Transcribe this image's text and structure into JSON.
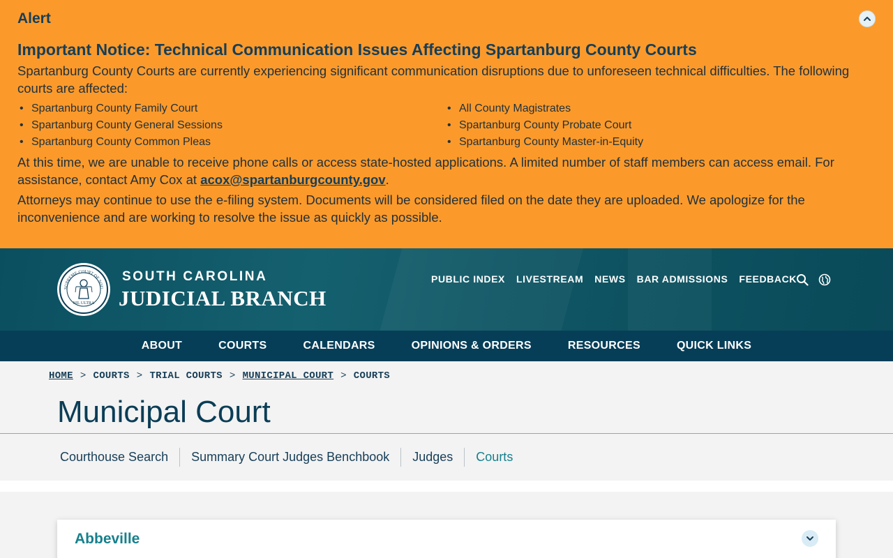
{
  "alert": {
    "title": "Alert",
    "heading": "Important Notice: Technical Communication Issues Affecting Spartanburg County Courts",
    "intro": "Spartanburg County Courts are currently experiencing significant communication disruptions due to unforeseen technical difficulties. The following courts are affected:",
    "courts_left": [
      "Spartanburg County Family Court",
      "Spartanburg County General Sessions",
      "Spartanburg County Common Pleas"
    ],
    "courts_right": [
      "All County Magistrates",
      "Spartanburg County Probate Court",
      "Spartanburg County Master-in-Equity"
    ],
    "para2_text": "At this time, we are unable to receive phone calls or access state-hosted applications. A limited number of staff members can access email. For assistance, contact Amy Cox at ",
    "contact_email": "acox@spartanburgcounty.gov",
    "para2_end": ".",
    "para3": "Attorneys may continue to use the e-filing system. Documents will be considered filed on the date they are uploaded. We apologize for the inconvenience and are working to resolve the issue as quickly as possible.",
    "color": "#fb9a2b"
  },
  "header": {
    "brand_top": "SOUTH CAROLINA",
    "brand_main": "JUDICIAL BRANCH",
    "seal_text_top": "SUPREME COURT OF SOUTH CAROLINA",
    "seal_text_bottom": "NIL ULTRA",
    "utility_links": [
      "PUBLIC INDEX",
      "LIVESTREAM",
      "NEWS",
      "BAR ADMISSIONS",
      "FEEDBACK"
    ],
    "icons": [
      "search-icon",
      "globe-icon"
    ]
  },
  "main_nav": [
    "ABOUT",
    "COURTS",
    "CALENDARS",
    "OPINIONS & ORDERS",
    "RESOURCES",
    "QUICK LINKS"
  ],
  "breadcrumb": {
    "items": [
      "HOME",
      "COURTS",
      "TRIAL COURTS",
      "MUNICIPAL COURT",
      "COURTS"
    ],
    "separator": ">"
  },
  "page_title": "Municipal Court",
  "subnav": {
    "items": [
      "Courthouse Search",
      "Summary Court Judges Benchbook",
      "Judges",
      "Courts"
    ],
    "active": "Courts"
  },
  "accordion": {
    "first_item": "Abbeville"
  },
  "colors": {
    "alert_bg": "#fb9a2b",
    "header_bg": "#0a4f60",
    "nav_bg": "#063e58",
    "accent_teal": "#17808c",
    "navy_text": "#173e57"
  }
}
